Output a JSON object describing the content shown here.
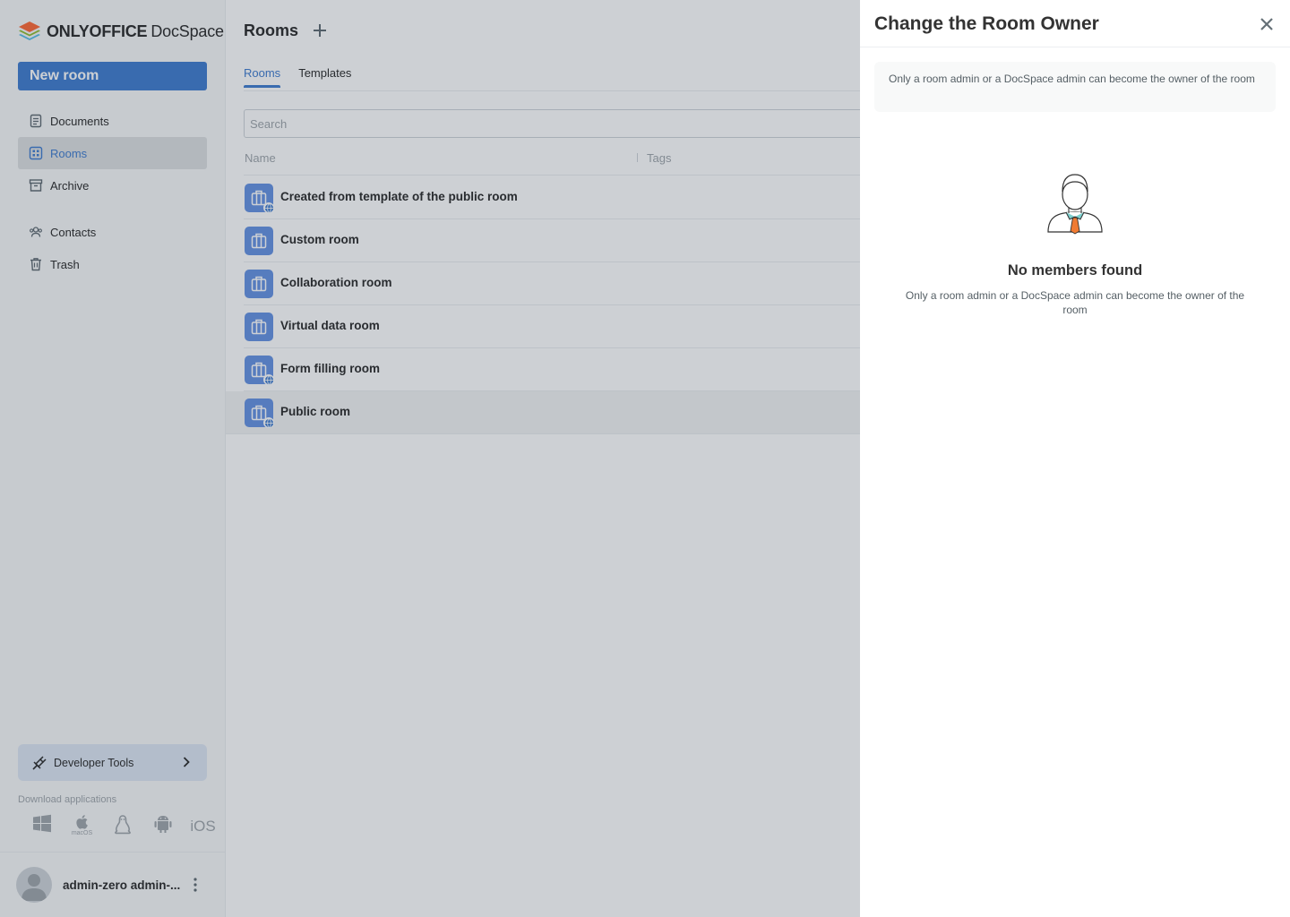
{
  "brand": {
    "name_bold": "ONLYOFFICE",
    "name_light": "DocSpace"
  },
  "sidebar": {
    "new_room_label": "New room",
    "items": [
      {
        "label": "Documents",
        "icon": "documents-icon"
      },
      {
        "label": "Rooms",
        "icon": "rooms-icon",
        "active": true
      },
      {
        "label": "Archive",
        "icon": "archive-icon"
      },
      {
        "label": "Contacts",
        "icon": "contacts-icon"
      },
      {
        "label": "Trash",
        "icon": "trash-icon"
      }
    ],
    "developer_tools_label": "Developer Tools",
    "download_label": "Download applications",
    "apps": [
      {
        "icon": "windows-icon",
        "label": ""
      },
      {
        "icon": "apple-icon",
        "label": "macOS"
      },
      {
        "icon": "linux-icon",
        "label": ""
      },
      {
        "icon": "android-icon",
        "label": ""
      },
      {
        "icon": "ios-icon",
        "label": "iOS"
      }
    ],
    "user_name": "admin-zero admin-..."
  },
  "main": {
    "title": "Rooms",
    "tabs": [
      {
        "label": "Rooms",
        "active": true
      },
      {
        "label": "Templates",
        "active": false
      }
    ],
    "search_placeholder": "Search",
    "columns": {
      "name": "Name",
      "tags": "Tags"
    },
    "rooms": [
      {
        "name": "Created from template of the public room",
        "public": true
      },
      {
        "name": "Custom room",
        "public": false
      },
      {
        "name": "Collaboration room",
        "public": false
      },
      {
        "name": "Virtual data room",
        "public": false
      },
      {
        "name": "Form filling room",
        "public": true
      },
      {
        "name": "Public room",
        "public": true,
        "selected": true
      }
    ]
  },
  "panel": {
    "title": "Change the Room Owner",
    "info_text": "Only a room admin or a DocSpace admin can become the owner of the room",
    "empty_title": "No members found",
    "empty_description": "Only a room admin or a DocSpace admin can become the owner of the room"
  },
  "colors": {
    "accent": "#4781d1",
    "room_icon": "#6b96e4",
    "overlay": "rgba(6,22,38,0.2)"
  }
}
